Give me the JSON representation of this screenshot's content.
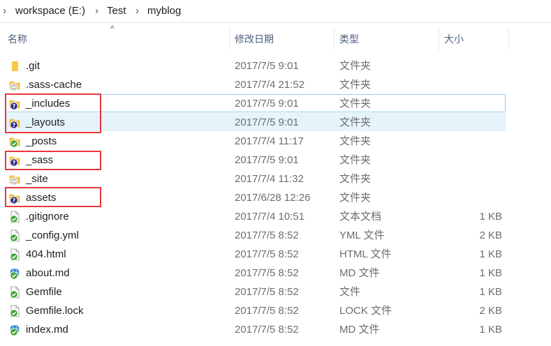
{
  "breadcrumb": {
    "items": [
      "workspace (E:)",
      "Test",
      "myblog"
    ]
  },
  "columns": {
    "name": "名称",
    "date": "修改日期",
    "type": "类型",
    "size": "大小"
  },
  "colors": {
    "folder": "#f6c845",
    "git_ok": "#3fa535",
    "git_unknown": "#2b2f8f",
    "ignored": "#c8c8c8",
    "highlight": "#e8383d",
    "selected": "#e5f3fb"
  },
  "files": [
    {
      "name": ".git",
      "date": "2017/7/5 9:01",
      "type": "文件夹",
      "size": "",
      "icon": "folder-icon"
    },
    {
      "name": ".sass-cache",
      "date": "2017/7/4 21:52",
      "type": "文件夹",
      "size": "",
      "icon": "folder-ignored-icon"
    },
    {
      "name": "_includes",
      "date": "2017/7/5 9:01",
      "type": "文件夹",
      "size": "",
      "icon": "folder-unversioned-icon"
    },
    {
      "name": "_layouts",
      "date": "2017/7/5 9:01",
      "type": "文件夹",
      "size": "",
      "icon": "folder-unversioned-icon"
    },
    {
      "name": "_posts",
      "date": "2017/7/4 11:17",
      "type": "文件夹",
      "size": "",
      "icon": "folder-ok-icon"
    },
    {
      "name": "_sass",
      "date": "2017/7/5 9:01",
      "type": "文件夹",
      "size": "",
      "icon": "folder-unversioned-icon"
    },
    {
      "name": "_site",
      "date": "2017/7/4 11:32",
      "type": "文件夹",
      "size": "",
      "icon": "folder-ignored-icon"
    },
    {
      "name": "assets",
      "date": "2017/6/28 12:26",
      "type": "文件夹",
      "size": "",
      "icon": "folder-unversioned-icon"
    },
    {
      "name": ".gitignore",
      "date": "2017/7/4 10:51",
      "type": "文本文档",
      "size": "1 KB",
      "icon": "file-ok-icon"
    },
    {
      "name": "_config.yml",
      "date": "2017/7/5 8:52",
      "type": "YML 文件",
      "size": "2 KB",
      "icon": "file-ok-icon"
    },
    {
      "name": "404.html",
      "date": "2017/7/5 8:52",
      "type": "HTML 文件",
      "size": "1 KB",
      "icon": "file-ok-icon"
    },
    {
      "name": "about.md",
      "date": "2017/7/5 8:52",
      "type": "MD 文件",
      "size": "1 KB",
      "icon": "browser-ok-icon"
    },
    {
      "name": "Gemfile",
      "date": "2017/7/5 8:52",
      "type": "文件",
      "size": "1 KB",
      "icon": "file-ok-icon"
    },
    {
      "name": "Gemfile.lock",
      "date": "2017/7/5 8:52",
      "type": "LOCK 文件",
      "size": "2 KB",
      "icon": "file-ok-icon"
    },
    {
      "name": "index.md",
      "date": "2017/7/5 8:52",
      "type": "MD 文件",
      "size": "1 KB",
      "icon": "browser-ok-icon"
    }
  ]
}
